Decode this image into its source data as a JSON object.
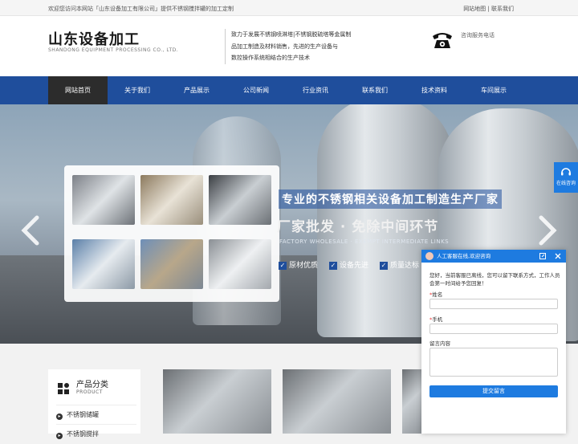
{
  "topbar": {
    "welcome": "欢迎您访问本网站「山东设备加工有限公司」提供不锈钢搅拌罐的加工定制",
    "sitemap": "网站地图",
    "separator": " | ",
    "contact": "联系我们"
  },
  "header": {
    "logo_cn": "山东设备加工",
    "logo_en": "SHANDONG EQUIPMENT PROCESSING CO., LTD.",
    "slogan_lines": [
      "致力于发展不锈钢喷淋塔|不锈钢脱硫塔等金属制",
      "品加工制造及材料销售，先进的生产设备与",
      "数控操作系统相结合的生产技术"
    ],
    "phone_label": "咨询服务电话"
  },
  "nav": {
    "items": [
      "网站首页",
      "关于我们",
      "产品展示",
      "公司新闻",
      "行业资讯",
      "联系我们",
      "技术资料",
      "车间展示"
    ]
  },
  "banner": {
    "headline_prefix": "专业的",
    "headline_highlight": "不锈钢相关设备加工制造生产厂家",
    "sub": "厂家批发 · 免除中间环节",
    "sub_en": "FACTORY WHOLESALE · EXEMPT INTERMEDIATE LINKS",
    "features": [
      "原材优质",
      "设备先进",
      "质量达标"
    ]
  },
  "float_consult": {
    "label": "在线咨询"
  },
  "category": {
    "title": "产品分类",
    "title_en": "PRODUCT",
    "items": [
      "不锈钢储罐",
      "不锈钢搅拌"
    ]
  },
  "chat": {
    "title": "人工客服在线,欢迎咨询",
    "message": "您好，当前客服已离线，您可以留下联系方式，工作人员会第一时间给予您回复！",
    "name_label": "姓名",
    "phone_label": "手机",
    "message_label": "留言内容",
    "required_mark": "*",
    "submit": "提交留言"
  },
  "colors": {
    "nav_bg": "#1f4e9c",
    "nav_active": "#2c2c2c",
    "accent": "#1e7be0"
  }
}
